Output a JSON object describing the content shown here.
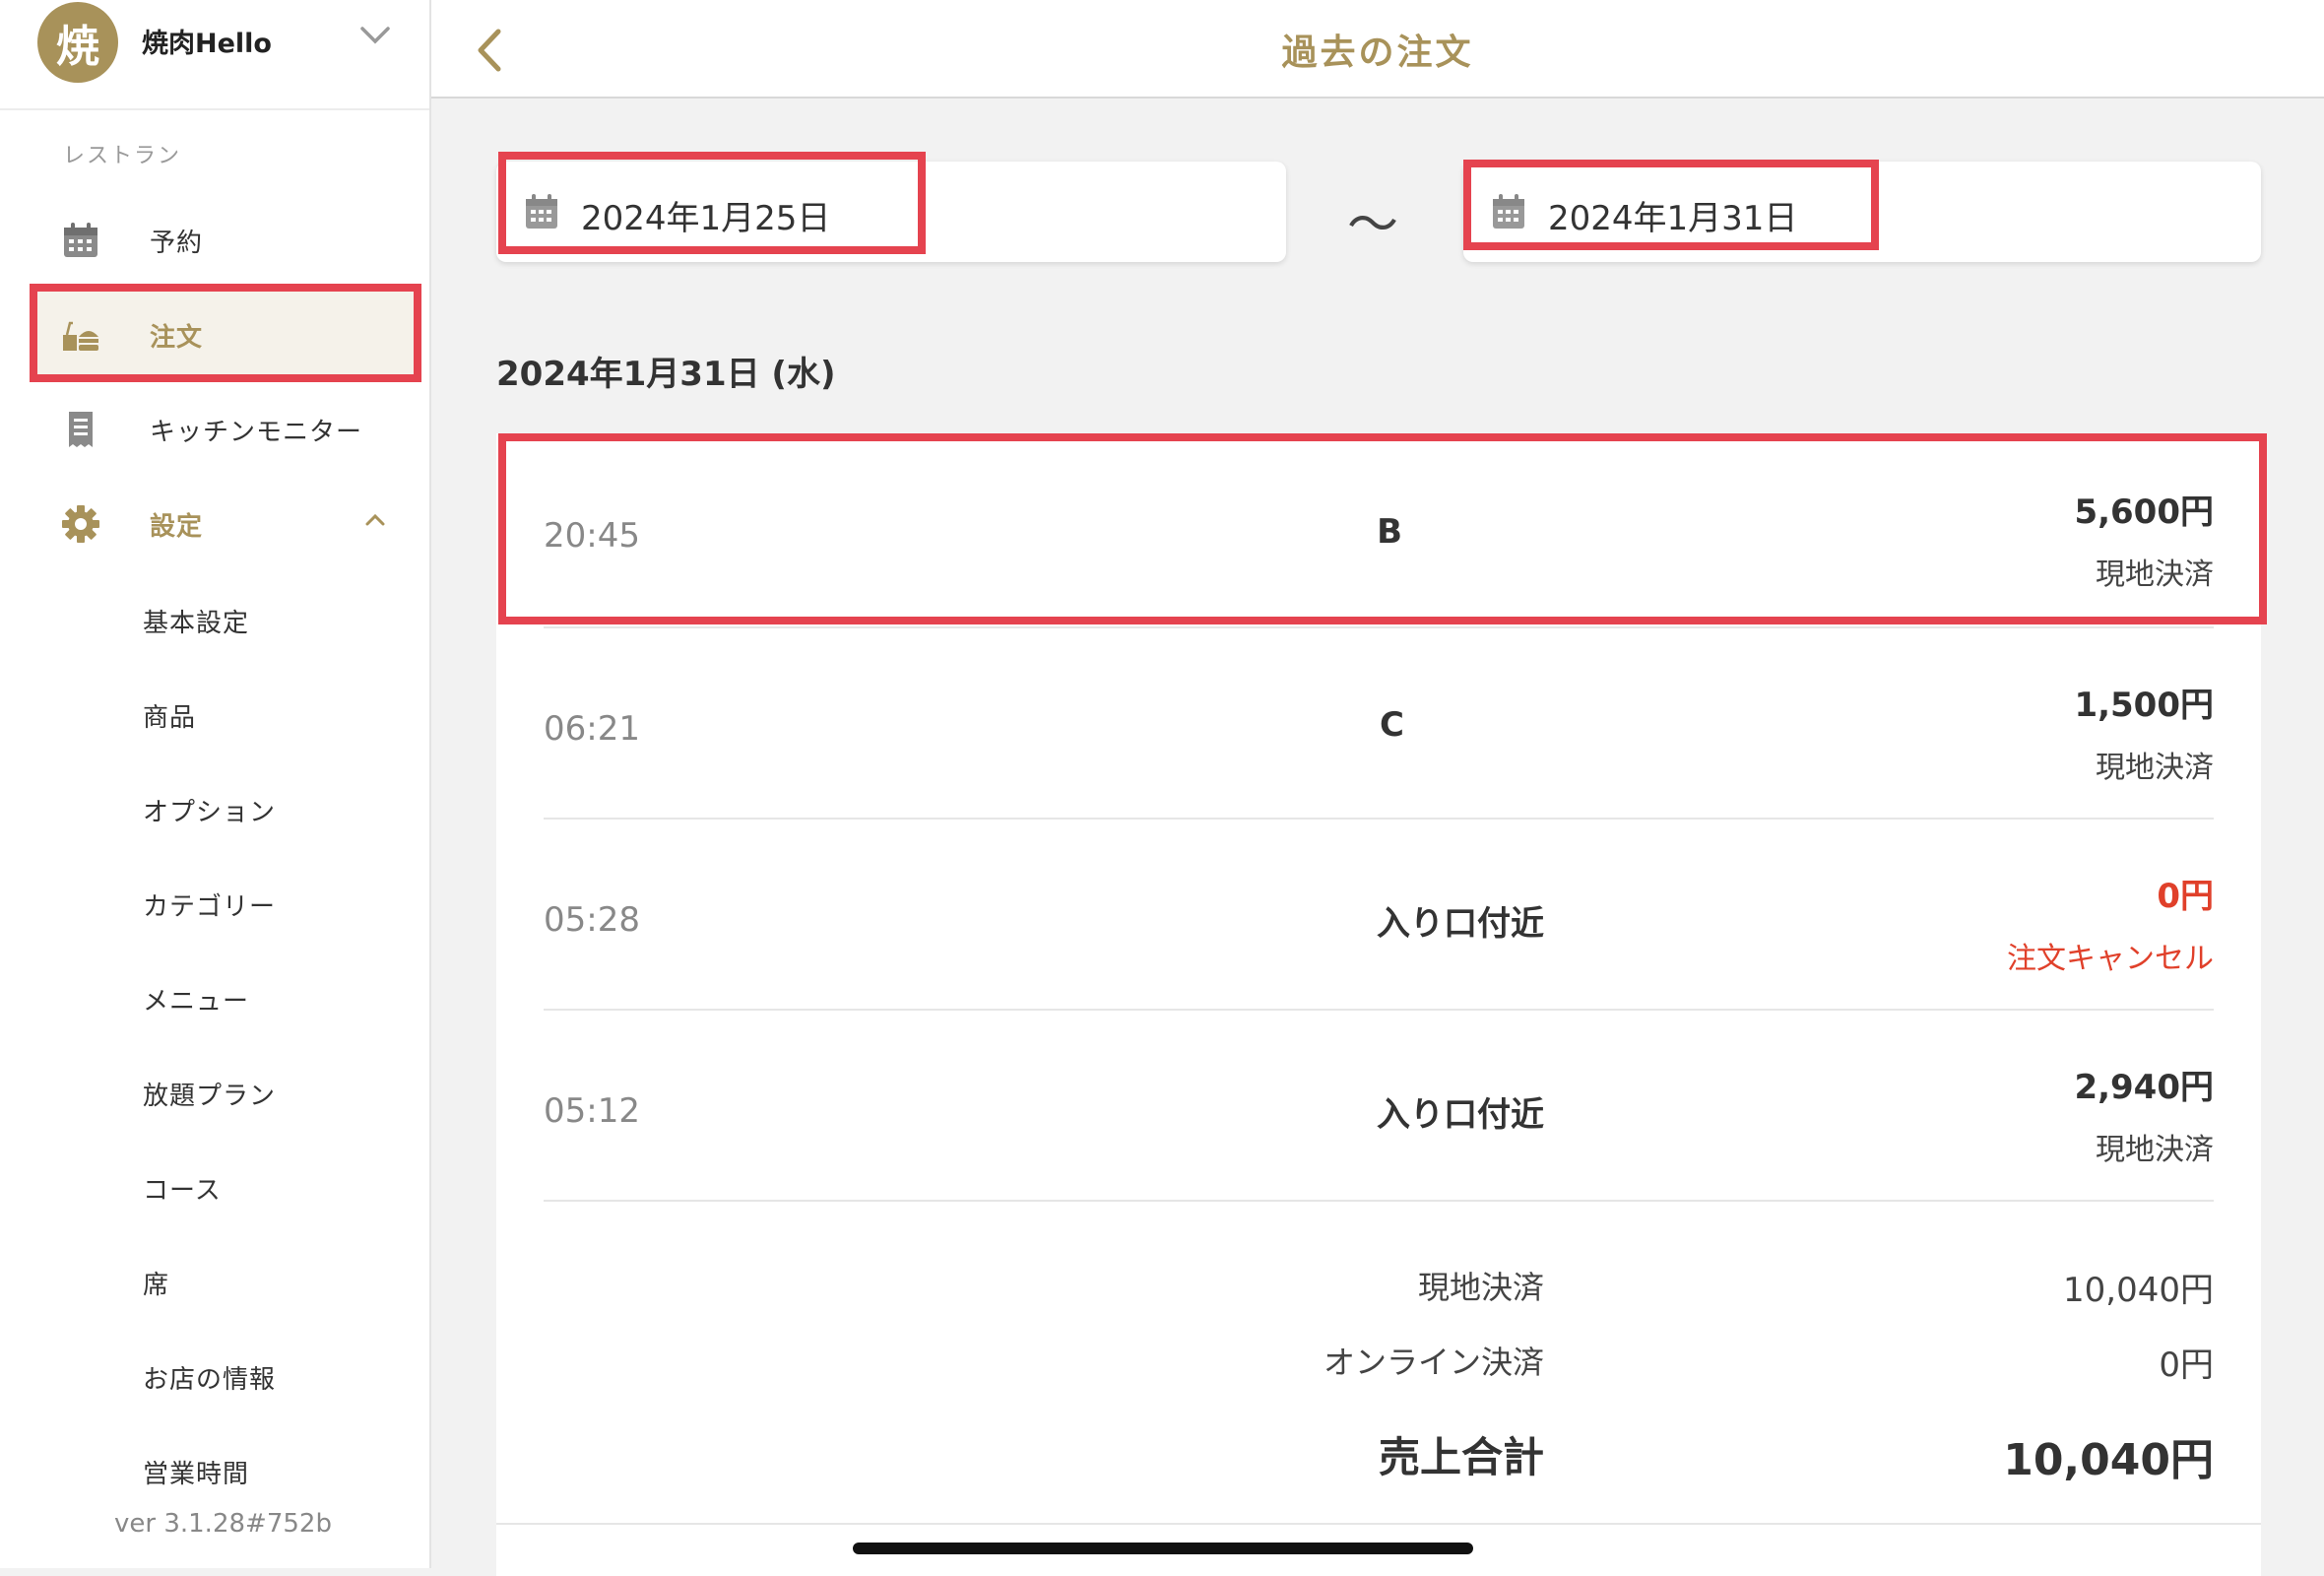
{
  "shop": {
    "avatar_char": "焼",
    "name": "焼肉Hello"
  },
  "sidebar": {
    "section_label": "レストラン",
    "items": [
      {
        "label": "予約",
        "icon": "calendar-icon"
      },
      {
        "label": "注文",
        "icon": "order-basket-icon",
        "active": true
      },
      {
        "label": "キッチンモニター",
        "icon": "receipt-icon"
      },
      {
        "label": "設定",
        "icon": "gear-icon",
        "expanded": true
      }
    ],
    "settings_sub": [
      "基本設定",
      "商品",
      "オプション",
      "カテゴリー",
      "メニュー",
      "放題プラン",
      "コース",
      "席",
      "お店の情報",
      "営業時間"
    ],
    "version": "ver 3.1.28#752b"
  },
  "header": {
    "title": "過去の注文"
  },
  "filters": {
    "from_date": "2024年1月25日",
    "separator": "〜",
    "to_date": "2024年1月31日"
  },
  "day": {
    "heading": "2024年1月31日 (水)",
    "orders": [
      {
        "time": "20:45",
        "table": "B",
        "amount": "5,600円",
        "status": "現地決済",
        "cancelled": false
      },
      {
        "time": "06:21",
        "table": "C",
        "amount": "1,500円",
        "status": "現地決済",
        "cancelled": false
      },
      {
        "time": "05:28",
        "table": "入り口付近",
        "amount": "0円",
        "status": "注文キャンセル",
        "cancelled": true
      },
      {
        "time": "05:12",
        "table": "入り口付近",
        "amount": "2,940円",
        "status": "現地決済",
        "cancelled": false
      }
    ],
    "summary": {
      "onsite_label": "現地決済",
      "onsite_value": "10,040円",
      "online_label": "オンライン決済",
      "online_value": "0円",
      "total_label": "売上合計",
      "total_value": "10,040円"
    }
  },
  "colors": {
    "accent": "#a8925a",
    "highlight": "#e5434f",
    "cancel": "#e0402a"
  }
}
